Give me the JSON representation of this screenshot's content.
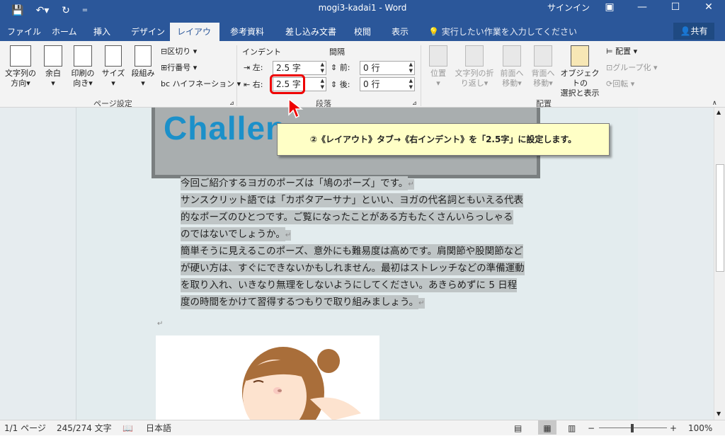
{
  "titlebar": {
    "title": "mogi3-kadai1 - Word",
    "signin": "サインイン"
  },
  "tabs": [
    "ファイル",
    "ホーム",
    "挿入",
    "デザイン",
    "レイアウト",
    "参考資料",
    "差し込み文書",
    "校閲",
    "表示"
  ],
  "tellme": "実行したい作業を入力してください",
  "share": "共有",
  "ribbon": {
    "page_setup": {
      "text_dir_l1": "文字列の",
      "text_dir_l2": "方向",
      "margins": "余白",
      "orient_l1": "印刷の",
      "orient_l2": "向き",
      "size": "サイズ",
      "columns": "段組み",
      "breaks": "区切り",
      "line_numbers": "行番号",
      "hyphen": "ハイフネーション",
      "label": "ページ設定"
    },
    "paragraph": {
      "indent_title": "インデント",
      "spacing_title": "間隔",
      "left_label": "左:",
      "left_value": "2.5 字",
      "right_label": "右:",
      "right_value": "2.5 字",
      "before_label": "前:",
      "before_value": "0 行",
      "after_label": "後:",
      "after_value": "0 行",
      "label": "段落"
    },
    "arrange": {
      "position": "位置",
      "wrap_l1": "文字列の折",
      "wrap_l2": "り返し",
      "forward_l1": "前面へ",
      "forward_l2": "移動",
      "back_l1": "背面へ",
      "back_l2": "移動",
      "select_l1": "オブジェクトの",
      "select_l2": "選択と表示",
      "align": "配置",
      "group": "グループ化",
      "rotate": "回転",
      "label": "配置"
    }
  },
  "tooltip": "②《レイアウト》タブ→《右インデント》を「2.5字」に設定します。",
  "banner": {
    "text": "Challen"
  },
  "document": {
    "lines": [
      "今回ご紹介するヨガのポーズは「鳩のポーズ」です。",
      "サンスクリット語では「カポタアーサナ」といい、ヨガの代名詞ともいえる代表",
      "的なポーズのひとつです。ご覧になったことがある方もたくさんいらっしゃる",
      "のではないでしょうか。",
      "簡単そうに見えるこのポーズ、意外にも難易度は高めです。肩関節や股関節など",
      "が硬い方は、すぐにできないかもしれません。最初はストレッチなどの準備運動",
      "を取り入れ、いきなり無理をしないようにしてください。あきらめずに 5 日程",
      "度の時間をかけて習得するつもりで取り組みましょう。"
    ]
  },
  "status": {
    "page": "1/1 ページ",
    "words": "245/274 文字",
    "lang": "日本語",
    "zoom": "100%"
  },
  "colors": {
    "accent": "#2b579a",
    "highlight": "#e00000",
    "tooltip_bg": "#ffffc6"
  }
}
